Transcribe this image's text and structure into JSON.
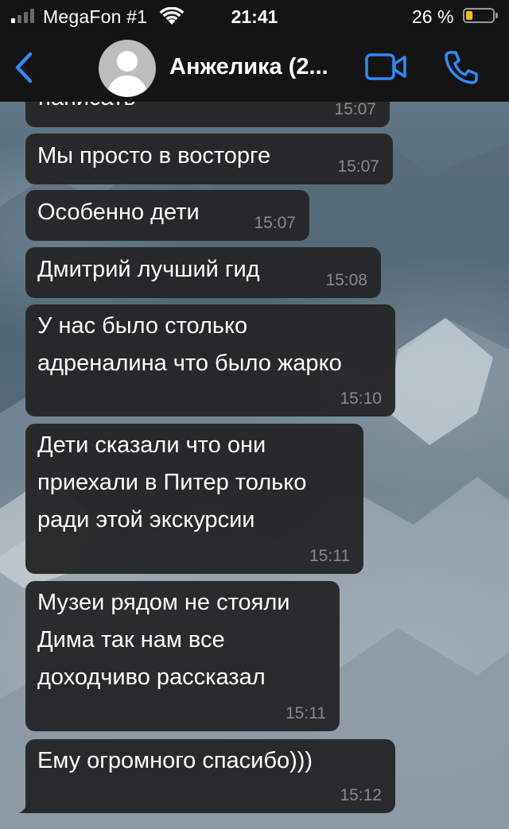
{
  "status_bar": {
    "carrier": "MegaFon #1",
    "time": "21:41",
    "battery_percent": "26 %",
    "battery_level": 0.26,
    "battery_color": "#f2c200",
    "signal_bars_total": 4,
    "signal_bars_active": 1
  },
  "header": {
    "title": "Анжелика (2...",
    "back_icon": "chevron-left-icon",
    "video_icon": "video-camera-icon",
    "phone_icon": "phone-icon",
    "avatar_icon": "person-placeholder-icon",
    "accent_color": "#2d8cff"
  },
  "messages": [
    {
      "text": "написать",
      "time": "15:07"
    },
    {
      "text": "Мы просто в восторге",
      "time": "15:07"
    },
    {
      "text": "Особенно дети",
      "time": "15:07"
    },
    {
      "text": "Дмитрий лучший гид",
      "time": "15:08"
    },
    {
      "lines": [
        "У нас было столько",
        "адреналина что было жарко"
      ],
      "time": "15:10"
    },
    {
      "lines": [
        "Дети сказали что они",
        "приехали в Питер только",
        "ради этой экскурсии"
      ],
      "time": "15:11"
    },
    {
      "lines": [
        "Музеи рядом не стояли",
        "Дима так нам все",
        "доходчиво рассказал"
      ],
      "time": "15:11"
    },
    {
      "text": "Ему огромного спасибо)))",
      "time": "15:12"
    }
  ]
}
